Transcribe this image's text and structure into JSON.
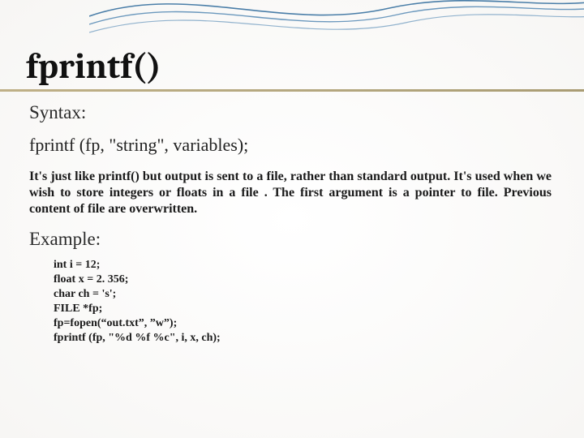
{
  "title": "fprintf()",
  "labels": {
    "syntax": "Syntax:",
    "example": "Example:"
  },
  "signature": "fprintf (fp, \"string\", variables);",
  "description": "It's just like printf() but output is  sent  to a file, rather than standard  output.\nIt's used when we wish to store  integers  or floats in a  file . The first  argument  is  a  pointer  to  file.  Previous   content  of   file  are  overwritten.",
  "code": "int i = 12;\nfloat x = 2. 356;\nchar ch = 's';\nFILE *fp;\nfp=fopen(“out.txt”, ”w”);\nfprintf (fp, \"%d %f %c\", i, x, ch);"
}
